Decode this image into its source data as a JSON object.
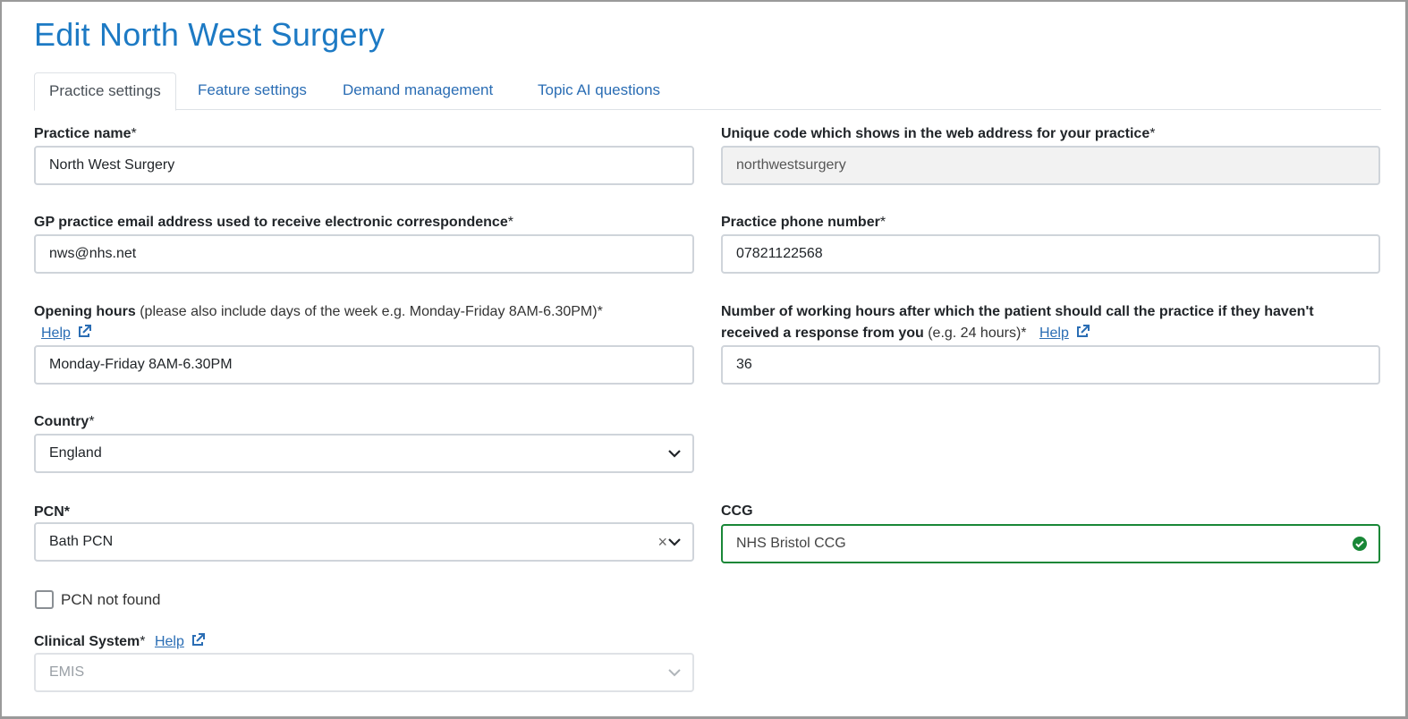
{
  "page": {
    "title": "Edit North West Surgery"
  },
  "tabs": [
    {
      "label": "Practice settings",
      "active": true
    },
    {
      "label": "Feature settings",
      "active": false
    },
    {
      "label": "Demand management",
      "active": false
    },
    {
      "label": "Topic AI questions",
      "active": false
    }
  ],
  "form": {
    "practice_name": {
      "label": "Practice name",
      "required": "*",
      "value": "North West Surgery"
    },
    "unique_code": {
      "label": "Unique code which shows in the web address for your practice",
      "required": "*",
      "value": "northwestsurgery"
    },
    "email": {
      "label": "GP practice email address used to receive electronic correspondence",
      "required": "*",
      "value": "nws@nhs.net"
    },
    "phone": {
      "label": "Practice phone number",
      "required": "*",
      "value": "07821122568"
    },
    "opening_hours": {
      "label": "Opening hours",
      "note": " (please also include days of the week e.g. Monday-Friday 8AM-6.30PM)*",
      "help": "Help",
      "value": "Monday-Friday 8AM-6.30PM"
    },
    "working_hours": {
      "label_line1": "Number of working hours after which the patient should call the practice if they haven't",
      "label_line2": "received a response from you",
      "note": " (e.g. 24 hours)*",
      "help": "Help",
      "value": "36"
    },
    "country": {
      "label": "Country",
      "required": "*",
      "value": "England"
    },
    "pcn": {
      "label": "PCN*",
      "value": "Bath PCN",
      "clear": "×"
    },
    "ccg": {
      "label": "CCG",
      "value": "NHS Bristol CCG"
    },
    "pcn_not_found": {
      "label": "PCN not found",
      "checked": false
    },
    "clinical_system": {
      "label": "Clinical System",
      "required": "*",
      "help": "Help",
      "value": "EMIS"
    }
  },
  "colors": {
    "accent": "#1d7ac4",
    "link": "#2a6db4",
    "valid": "#198737"
  }
}
